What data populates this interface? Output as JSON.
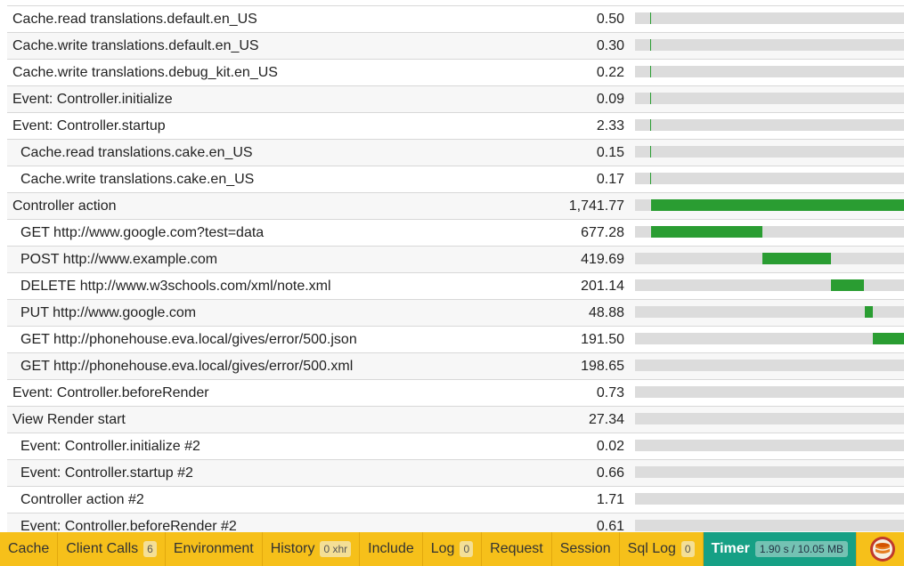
{
  "timeline": {
    "rows": [
      {
        "label": "Cache.read translations.default.en_US",
        "value": "0.50",
        "indent": false,
        "bar_start": 0.057,
        "bar_fraction": 0.0
      },
      {
        "label": "Cache.write translations.default.en_US",
        "value": "0.30",
        "indent": false,
        "bar_start": 0.057,
        "bar_fraction": 0.0
      },
      {
        "label": "Cache.write translations.debug_kit.en_US",
        "value": "0.22",
        "indent": false,
        "bar_start": 0.057,
        "bar_fraction": 0.0
      },
      {
        "label": "Event: Controller.initialize",
        "value": "0.09",
        "indent": false,
        "bar_start": 0.057,
        "bar_fraction": 0.0
      },
      {
        "label": "Event: Controller.startup",
        "value": "2.33",
        "indent": false,
        "bar_start": 0.057,
        "bar_fraction": 0.0
      },
      {
        "label": "Cache.read translations.cake.en_US",
        "value": "0.15",
        "indent": true,
        "bar_start": 0.057,
        "bar_fraction": 0.0
      },
      {
        "label": "Cache.write translations.cake.en_US",
        "value": "0.17",
        "indent": true,
        "bar_start": 0.057,
        "bar_fraction": 0.0
      },
      {
        "label": "Controller action",
        "value": "1,741.77",
        "indent": false,
        "bar_start": 0.06,
        "bar_fraction": 0.94
      },
      {
        "label": "GET http://www.google.com?test=data",
        "value": "677.28",
        "indent": true,
        "bar_start": 0.06,
        "bar_fraction": 0.414
      },
      {
        "label": "POST http://www.example.com",
        "value": "419.69",
        "indent": true,
        "bar_start": 0.474,
        "bar_fraction": 0.256
      },
      {
        "label": "DELETE http://www.w3schools.com/xml/note.xml",
        "value": "201.14",
        "indent": true,
        "bar_start": 0.73,
        "bar_fraction": 0.123
      },
      {
        "label": "PUT http://www.google.com",
        "value": "48.88",
        "indent": true,
        "bar_start": 0.853,
        "bar_fraction": 0.03
      },
      {
        "label": "GET http://phonehouse.eva.local/gives/error/500.json",
        "value": "191.50",
        "indent": true,
        "bar_start": 0.883,
        "bar_fraction": 0.117
      },
      {
        "label": "GET http://phonehouse.eva.local/gives/error/500.xml",
        "value": "198.65",
        "indent": true,
        "bar_start": 1.0,
        "bar_fraction": 0.0
      },
      {
        "label": "Event: Controller.beforeRender",
        "value": "0.73",
        "indent": false,
        "bar_start": 1.0,
        "bar_fraction": 0.0
      },
      {
        "label": "View Render start",
        "value": "27.34",
        "indent": false,
        "bar_start": 1.0,
        "bar_fraction": 0.0
      },
      {
        "label": "Event: Controller.initialize #2",
        "value": "0.02",
        "indent": true,
        "bar_start": 1.0,
        "bar_fraction": 0.0
      },
      {
        "label": "Event: Controller.startup #2",
        "value": "0.66",
        "indent": true,
        "bar_start": 1.0,
        "bar_fraction": 0.0
      },
      {
        "label": "Controller action #2",
        "value": "1.71",
        "indent": true,
        "bar_start": 1.0,
        "bar_fraction": 0.0
      },
      {
        "label": "Event: Controller.beforeRender #2",
        "value": "0.61",
        "indent": true,
        "bar_start": 1.0,
        "bar_fraction": 0.0
      }
    ],
    "bar_color": "#2a9d32",
    "track_color": "#dcdcdc"
  },
  "toolbar": {
    "tabs": [
      {
        "name": "cache",
        "label": "Cache",
        "badge": null
      },
      {
        "name": "client-calls",
        "label": "Client Calls",
        "badge": "6"
      },
      {
        "name": "environment",
        "label": "Environment",
        "badge": null
      },
      {
        "name": "history",
        "label": "History",
        "badge": "0 xhr"
      },
      {
        "name": "include",
        "label": "Include",
        "badge": null
      },
      {
        "name": "log",
        "label": "Log",
        "badge": "0"
      },
      {
        "name": "request",
        "label": "Request",
        "badge": null
      },
      {
        "name": "session",
        "label": "Session",
        "badge": null
      },
      {
        "name": "sql-log",
        "label": "Sql Log",
        "badge": "0"
      },
      {
        "name": "timer",
        "label": "Timer",
        "badge": "1.90 s / 10.05 MB",
        "active": true
      }
    ],
    "background": "#f6c01a",
    "active_color": "#16a085",
    "logo_icon": "cakephp-logo-icon"
  }
}
